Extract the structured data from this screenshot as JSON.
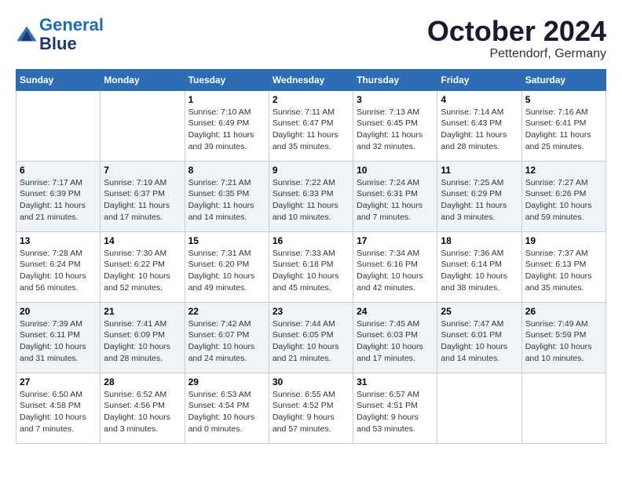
{
  "header": {
    "logo_line1": "General",
    "logo_line2": "Blue",
    "month": "October 2024",
    "location": "Pettendorf, Germany"
  },
  "weekdays": [
    "Sunday",
    "Monday",
    "Tuesday",
    "Wednesday",
    "Thursday",
    "Friday",
    "Saturday"
  ],
  "weeks": [
    [
      {
        "day": "",
        "info": ""
      },
      {
        "day": "",
        "info": ""
      },
      {
        "day": "1",
        "info": "Sunrise: 7:10 AM\nSunset: 6:49 PM\nDaylight: 11 hours and 39 minutes."
      },
      {
        "day": "2",
        "info": "Sunrise: 7:11 AM\nSunset: 6:47 PM\nDaylight: 11 hours and 35 minutes."
      },
      {
        "day": "3",
        "info": "Sunrise: 7:13 AM\nSunset: 6:45 PM\nDaylight: 11 hours and 32 minutes."
      },
      {
        "day": "4",
        "info": "Sunrise: 7:14 AM\nSunset: 6:43 PM\nDaylight: 11 hours and 28 minutes."
      },
      {
        "day": "5",
        "info": "Sunrise: 7:16 AM\nSunset: 6:41 PM\nDaylight: 11 hours and 25 minutes."
      }
    ],
    [
      {
        "day": "6",
        "info": "Sunrise: 7:17 AM\nSunset: 6:39 PM\nDaylight: 11 hours and 21 minutes."
      },
      {
        "day": "7",
        "info": "Sunrise: 7:19 AM\nSunset: 6:37 PM\nDaylight: 11 hours and 17 minutes."
      },
      {
        "day": "8",
        "info": "Sunrise: 7:21 AM\nSunset: 6:35 PM\nDaylight: 11 hours and 14 minutes."
      },
      {
        "day": "9",
        "info": "Sunrise: 7:22 AM\nSunset: 6:33 PM\nDaylight: 11 hours and 10 minutes."
      },
      {
        "day": "10",
        "info": "Sunrise: 7:24 AM\nSunset: 6:31 PM\nDaylight: 11 hours and 7 minutes."
      },
      {
        "day": "11",
        "info": "Sunrise: 7:25 AM\nSunset: 6:29 PM\nDaylight: 11 hours and 3 minutes."
      },
      {
        "day": "12",
        "info": "Sunrise: 7:27 AM\nSunset: 6:26 PM\nDaylight: 10 hours and 59 minutes."
      }
    ],
    [
      {
        "day": "13",
        "info": "Sunrise: 7:28 AM\nSunset: 6:24 PM\nDaylight: 10 hours and 56 minutes."
      },
      {
        "day": "14",
        "info": "Sunrise: 7:30 AM\nSunset: 6:22 PM\nDaylight: 10 hours and 52 minutes."
      },
      {
        "day": "15",
        "info": "Sunrise: 7:31 AM\nSunset: 6:20 PM\nDaylight: 10 hours and 49 minutes."
      },
      {
        "day": "16",
        "info": "Sunrise: 7:33 AM\nSunset: 6:18 PM\nDaylight: 10 hours and 45 minutes."
      },
      {
        "day": "17",
        "info": "Sunrise: 7:34 AM\nSunset: 6:16 PM\nDaylight: 10 hours and 42 minutes."
      },
      {
        "day": "18",
        "info": "Sunrise: 7:36 AM\nSunset: 6:14 PM\nDaylight: 10 hours and 38 minutes."
      },
      {
        "day": "19",
        "info": "Sunrise: 7:37 AM\nSunset: 6:13 PM\nDaylight: 10 hours and 35 minutes."
      }
    ],
    [
      {
        "day": "20",
        "info": "Sunrise: 7:39 AM\nSunset: 6:11 PM\nDaylight: 10 hours and 31 minutes."
      },
      {
        "day": "21",
        "info": "Sunrise: 7:41 AM\nSunset: 6:09 PM\nDaylight: 10 hours and 28 minutes."
      },
      {
        "day": "22",
        "info": "Sunrise: 7:42 AM\nSunset: 6:07 PM\nDaylight: 10 hours and 24 minutes."
      },
      {
        "day": "23",
        "info": "Sunrise: 7:44 AM\nSunset: 6:05 PM\nDaylight: 10 hours and 21 minutes."
      },
      {
        "day": "24",
        "info": "Sunrise: 7:45 AM\nSunset: 6:03 PM\nDaylight: 10 hours and 17 minutes."
      },
      {
        "day": "25",
        "info": "Sunrise: 7:47 AM\nSunset: 6:01 PM\nDaylight: 10 hours and 14 minutes."
      },
      {
        "day": "26",
        "info": "Sunrise: 7:49 AM\nSunset: 5:59 PM\nDaylight: 10 hours and 10 minutes."
      }
    ],
    [
      {
        "day": "27",
        "info": "Sunrise: 6:50 AM\nSunset: 4:58 PM\nDaylight: 10 hours and 7 minutes."
      },
      {
        "day": "28",
        "info": "Sunrise: 6:52 AM\nSunset: 4:56 PM\nDaylight: 10 hours and 3 minutes."
      },
      {
        "day": "29",
        "info": "Sunrise: 6:53 AM\nSunset: 4:54 PM\nDaylight: 10 hours and 0 minutes."
      },
      {
        "day": "30",
        "info": "Sunrise: 6:55 AM\nSunset: 4:52 PM\nDaylight: 9 hours and 57 minutes."
      },
      {
        "day": "31",
        "info": "Sunrise: 6:57 AM\nSunset: 4:51 PM\nDaylight: 9 hours and 53 minutes."
      },
      {
        "day": "",
        "info": ""
      },
      {
        "day": "",
        "info": ""
      }
    ]
  ]
}
